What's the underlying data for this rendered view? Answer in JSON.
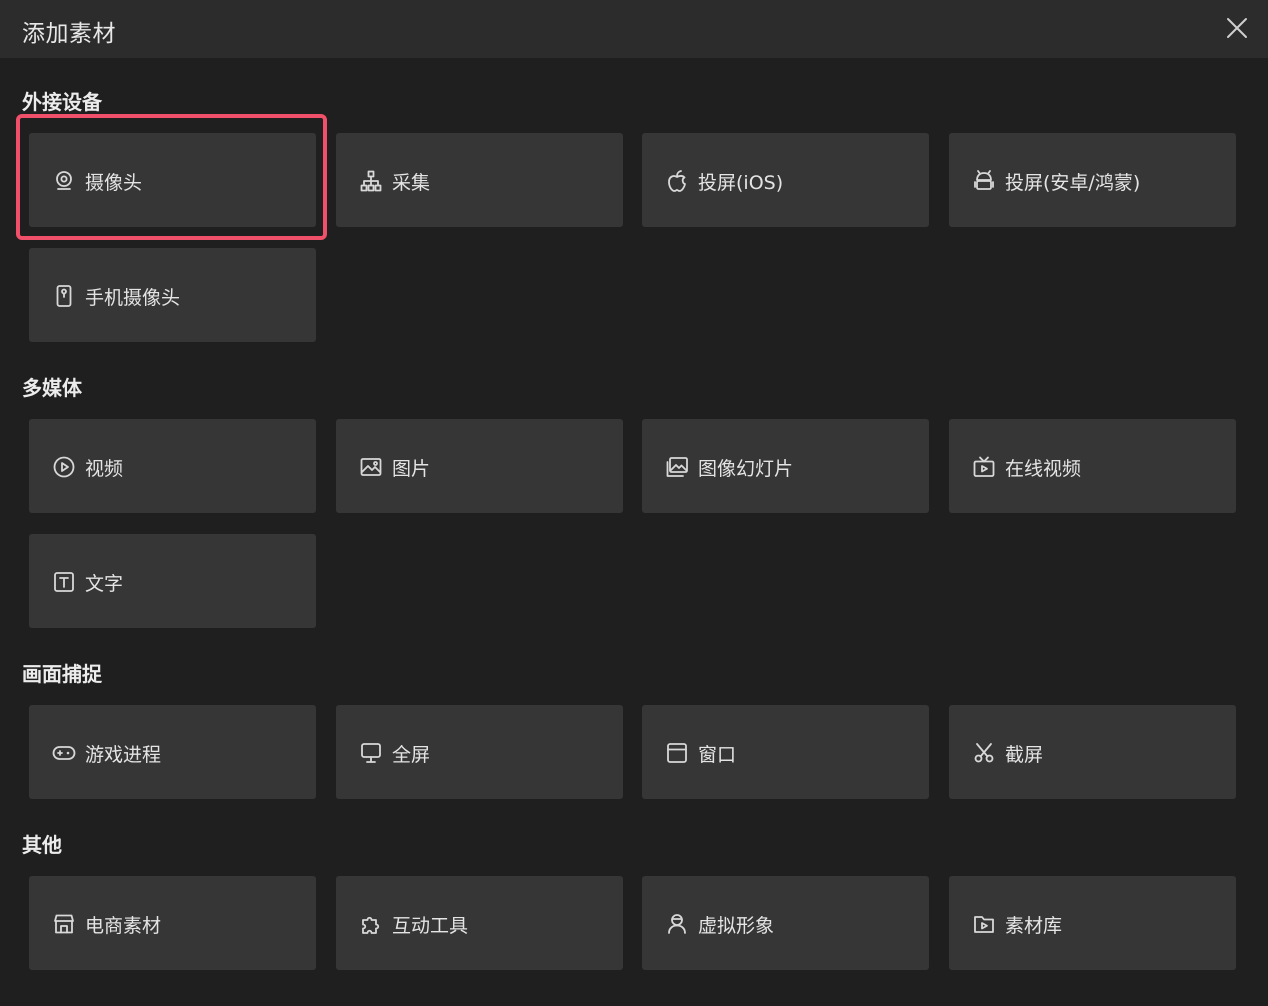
{
  "dialog": {
    "title": "添加素材"
  },
  "sections": {
    "external": {
      "label": "外接设备",
      "items": [
        "摄像头",
        "采集",
        "投屏(iOS)",
        "投屏(安卓/鸿蒙)",
        "手机摄像头"
      ]
    },
    "multimedia": {
      "label": "多媒体",
      "items": [
        "视频",
        "图片",
        "图像幻灯片",
        "在线视频",
        "文字"
      ]
    },
    "capture": {
      "label": "画面捕捉",
      "items": [
        "游戏进程",
        "全屏",
        "窗口",
        "截屏"
      ]
    },
    "other": {
      "label": "其他",
      "items": [
        "电商素材",
        "互动工具",
        "虚拟形象",
        "素材库"
      ]
    }
  },
  "icons": {
    "external": [
      "webcam-icon",
      "hierarchy-icon",
      "apple-icon",
      "android-icon",
      "phone-camera-icon"
    ],
    "multimedia": [
      "play-circle-icon",
      "image-icon",
      "slideshow-icon",
      "tv-icon",
      "text-icon"
    ],
    "capture": [
      "gamepad-icon",
      "monitor-icon",
      "window-icon",
      "scissors-icon"
    ],
    "other": [
      "shop-icon",
      "puzzle-icon",
      "avatar-icon",
      "library-icon"
    ]
  },
  "colors": {
    "background": "#1f1f1f",
    "titlebar": "#2c2c2c",
    "tile": "#363636",
    "highlight": "#f0506a",
    "text": "#e4e4e4"
  },
  "selected": "摄像头"
}
